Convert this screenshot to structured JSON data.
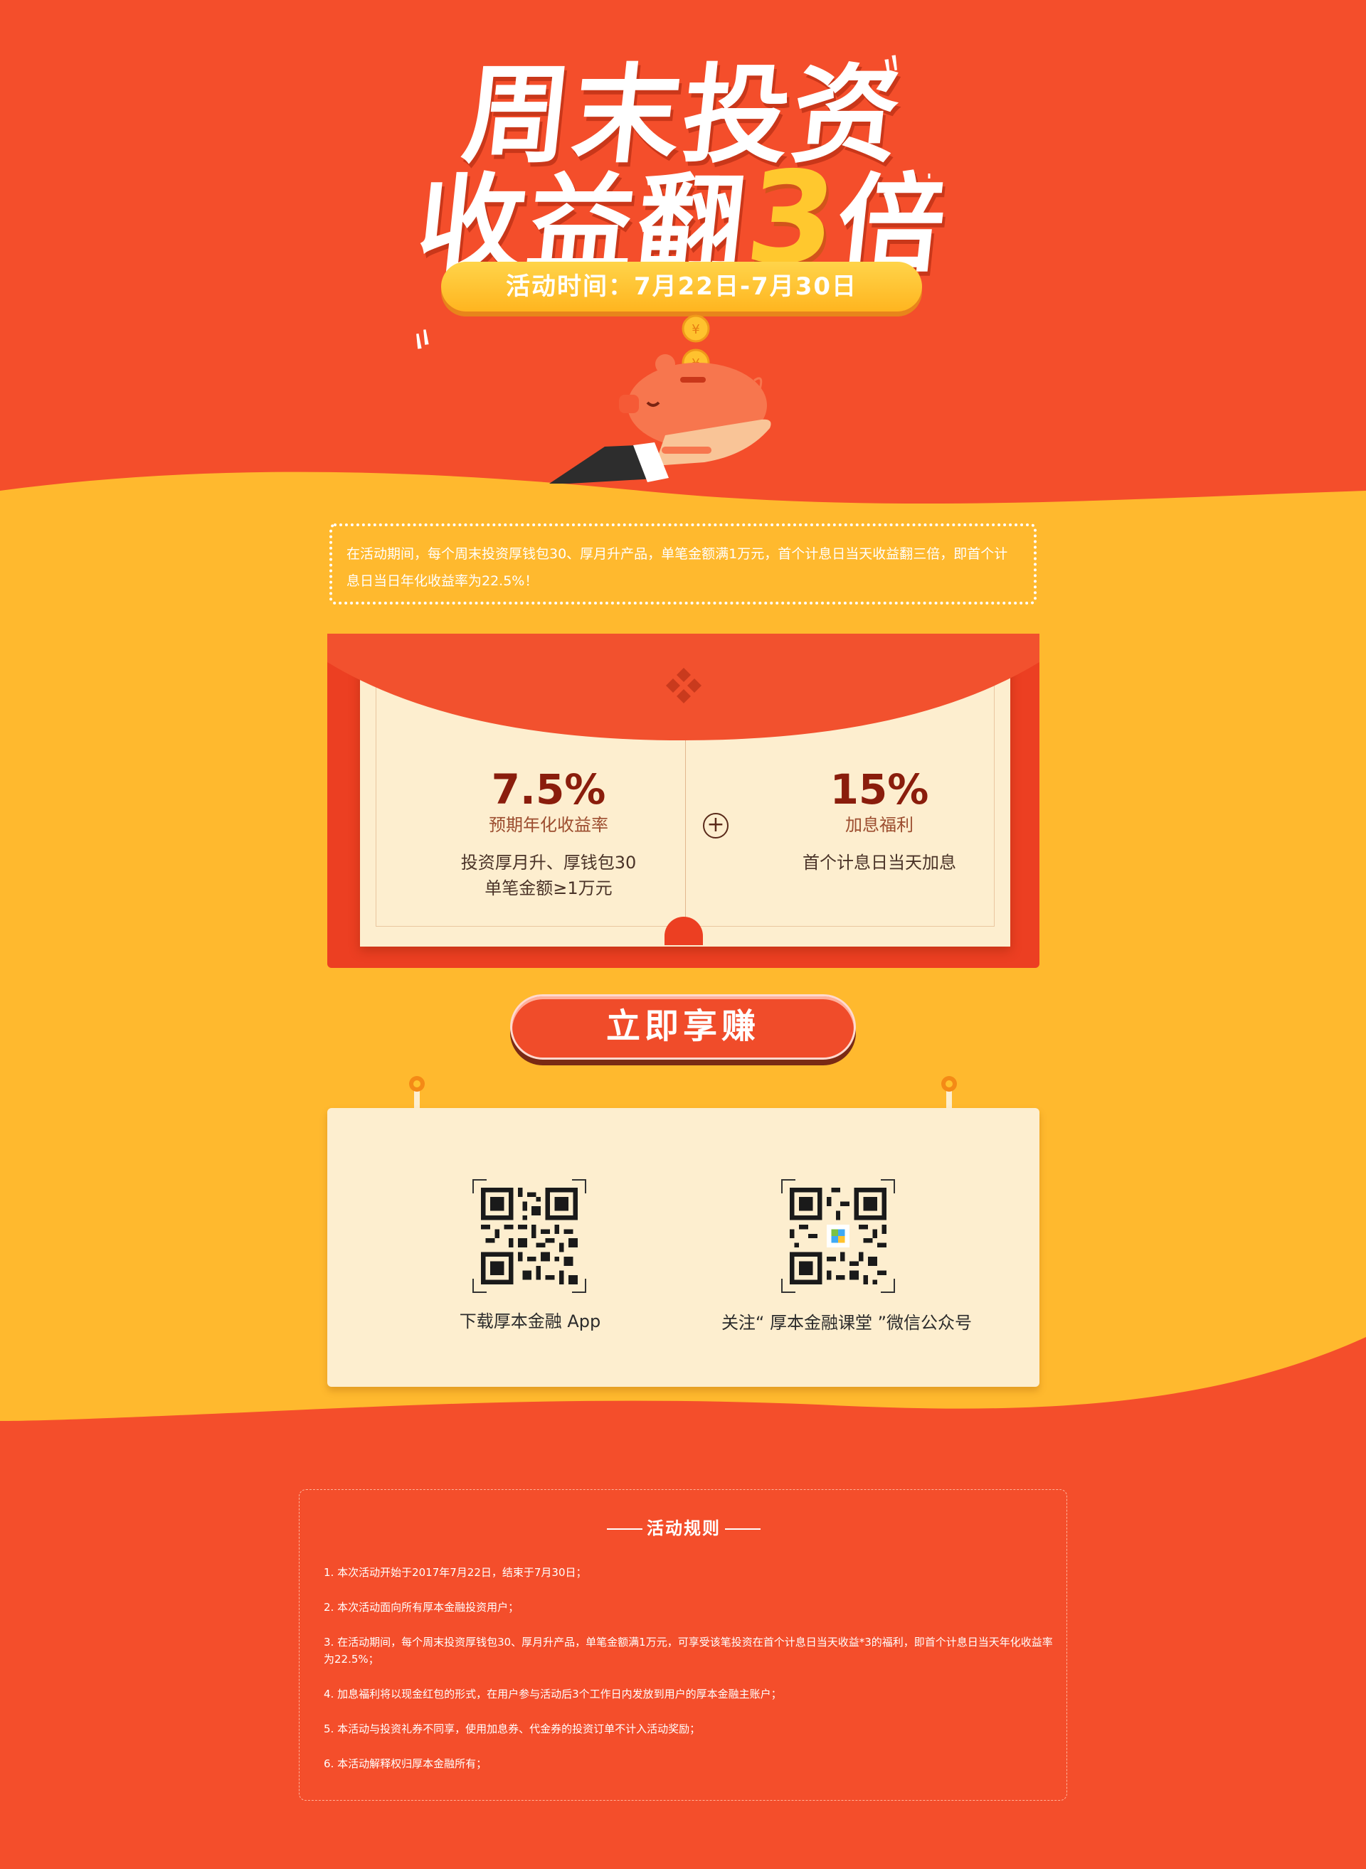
{
  "hero": {
    "title_line1": "周末投资",
    "title_line2_prefix": "收益翻",
    "title_line2_number": "3",
    "title_line2_suffix": "倍",
    "date_label": "活动时间：7月22日-7月30日"
  },
  "intro": {
    "text": "在活动期间，每个周末投资厚钱包30、厚月升产品，单笔金额满1万元，首个计息日当天收益翻三倍，即首个计息日当日年化收益率为22.5%！"
  },
  "envelope": {
    "left": {
      "rate": "7.5%",
      "label": "预期年化收益率",
      "desc_line1": "投资厚月升、厚钱包30",
      "desc_line2": "单笔金额≥1万元"
    },
    "plus": "+",
    "right": {
      "rate": "15%",
      "label": "加息福利",
      "desc_line1": "首个计息日当天加息"
    }
  },
  "cta": {
    "label": "立即享赚"
  },
  "qr": {
    "app_label": "下载厚本金融 App",
    "wechat_label": "关注“ 厚本金融课堂 ”微信公众号"
  },
  "rules": {
    "title": "活动规则",
    "items": [
      "1. 本次活动开始于2017年7月22日，结束于7月30日；",
      "2. 本次活动面向所有厚本金融投资用户；",
      "3. 在活动期间，每个周末投资厚钱包30、厚月升产品，单笔金额满1万元，可享受该笔投资在首个计息日当天收益*3的福利，即首个计息日当天年化收益率为22.5%；",
      "4. 加息福利将以现金红包的形式，在用户参与活动后3个工作日内发放到用户的厚本金融主账户；",
      "5. 本活动与投资礼券不同享，使用加息券、代金券的投资订单不计入活动奖励；",
      "6. 本活动解释权归厚本金融所有；"
    ]
  },
  "colors": {
    "red": "#f44e2b",
    "yellow": "#ffb92e",
    "cream": "#fdeecf",
    "dark_red": "#8a1d0c"
  }
}
